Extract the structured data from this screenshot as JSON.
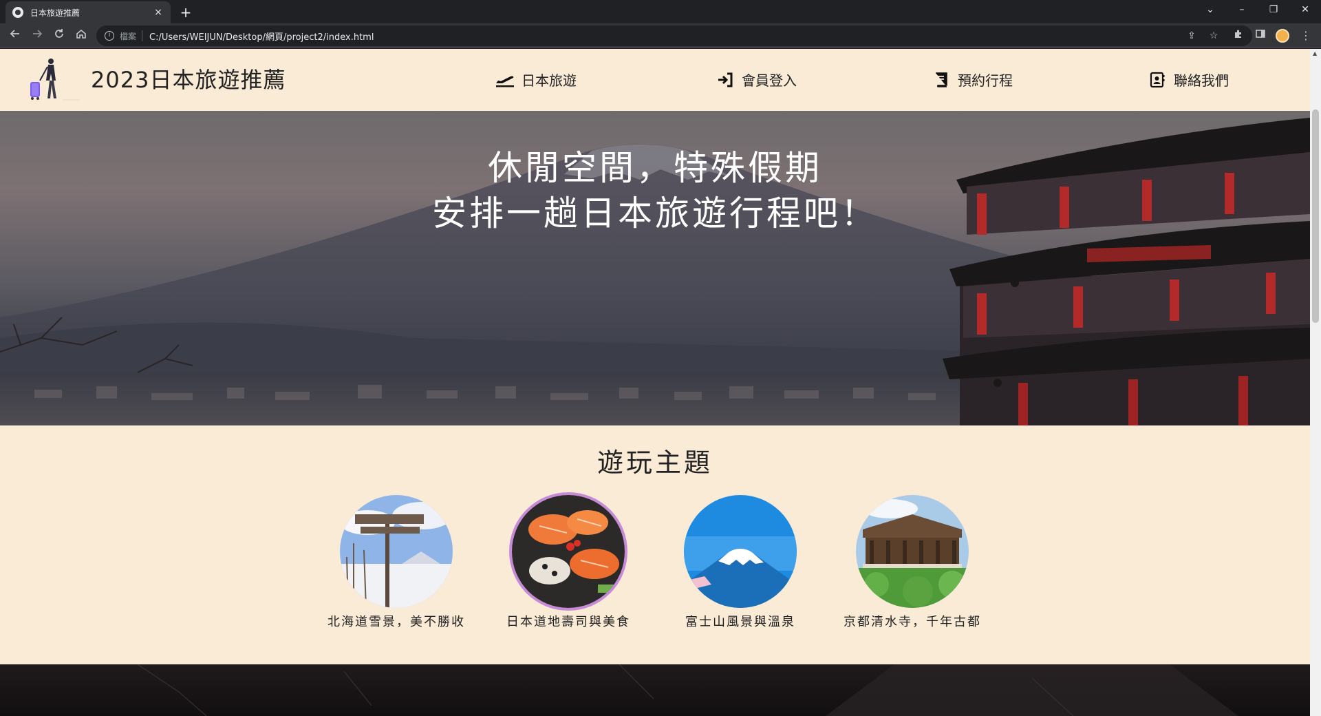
{
  "browser": {
    "tab_title": "日本旅遊推薦",
    "tab_close": "×",
    "new_tab": "+",
    "omnibox_scheme": "檔案",
    "url": "C:/Users/WEIJUN/Desktop/網頁/project2/index.html",
    "window_controls": {
      "tab_search": "⌄",
      "minimize": "–",
      "restore": "❐",
      "close": "✕"
    }
  },
  "site": {
    "title": "2023日本旅遊推薦",
    "nav": [
      {
        "label": "日本旅遊",
        "icon": "plane-departure-icon"
      },
      {
        "label": "會員登入",
        "icon": "sign-in-icon"
      },
      {
        "label": "預約行程",
        "icon": "book-icon"
      },
      {
        "label": "聯絡我們",
        "icon": "contact-card-icon"
      }
    ]
  },
  "hero": {
    "line1": "休閒空間，特殊假期",
    "line2": "安排一趟日本旅遊行程吧！"
  },
  "themes": {
    "heading": "遊玩主題",
    "items": [
      {
        "caption": "北海道雪景，美不勝收"
      },
      {
        "caption": "日本道地壽司與美食"
      },
      {
        "caption": "富士山風景與溫泉"
      },
      {
        "caption": "京都清水寺，千年古都"
      }
    ]
  }
}
